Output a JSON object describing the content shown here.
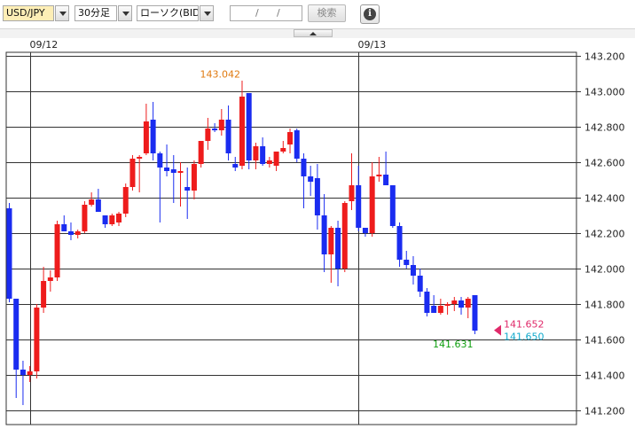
{
  "toolbar": {
    "pair": "USD/JPY",
    "interval": "30分足",
    "chart_type": "ローソク(BID)",
    "date_sep1": "/",
    "date_sep2": "/",
    "search_label": "検索",
    "info_icon": "info-icon"
  },
  "colors": {
    "up": "#ee1c1c",
    "down": "#1a2cf0",
    "grid": "#333333",
    "high_label": "#e07a10",
    "low_label": "#11a011",
    "price1": "#e02a6a",
    "price2": "#11aacc"
  },
  "chart_data": {
    "type": "candlestick",
    "y_range": [
      141.12,
      143.22
    ],
    "y_ticks": [
      "143.200",
      "143.000",
      "142.800",
      "142.600",
      "142.400",
      "142.200",
      "142.000",
      "141.800",
      "141.600",
      "141.400",
      "141.200"
    ],
    "date_labels": [
      {
        "text": "09/12",
        "index": 3
      },
      {
        "text": "09/13",
        "index": 51
      }
    ],
    "annotations": {
      "high": "143.042",
      "low": "141.631",
      "price_marker_1": "141.652",
      "price_marker_2": "141.650"
    },
    "ohlc": [
      [
        142.34,
        142.37,
        141.81,
        141.83
      ],
      [
        141.83,
        141.83,
        141.27,
        141.43
      ],
      [
        141.43,
        141.48,
        141.23,
        141.4
      ],
      [
        141.4,
        141.45,
        141.36,
        141.42
      ],
      [
        141.42,
        141.8,
        141.38,
        141.78
      ],
      [
        141.78,
        142.01,
        141.75,
        141.93
      ],
      [
        141.93,
        141.99,
        141.87,
        141.95
      ],
      [
        141.95,
        142.27,
        141.93,
        142.25
      ],
      [
        142.25,
        142.3,
        142.21,
        142.21
      ],
      [
        142.21,
        142.26,
        142.16,
        142.19
      ],
      [
        142.19,
        142.22,
        142.17,
        142.21
      ],
      [
        142.21,
        142.38,
        142.2,
        142.36
      ],
      [
        142.36,
        142.43,
        142.35,
        142.39
      ],
      [
        142.39,
        142.45,
        142.32,
        142.32
      ],
      [
        142.3,
        142.3,
        142.23,
        142.25
      ],
      [
        142.25,
        142.31,
        142.24,
        142.3
      ],
      [
        142.26,
        142.32,
        142.24,
        142.31
      ],
      [
        142.31,
        142.48,
        142.29,
        142.46
      ],
      [
        142.46,
        142.64,
        142.44,
        142.62
      ],
      [
        142.62,
        142.64,
        142.43,
        142.63
      ],
      [
        142.65,
        142.93,
        142.64,
        142.83
      ],
      [
        142.84,
        142.94,
        142.61,
        142.65
      ],
      [
        142.65,
        142.66,
        142.26,
        142.57
      ],
      [
        142.57,
        142.7,
        142.52,
        142.55
      ],
      [
        142.56,
        142.64,
        142.37,
        142.54
      ],
      [
        142.54,
        142.6,
        142.35,
        142.55
      ],
      [
        142.46,
        142.57,
        142.28,
        142.44
      ],
      [
        142.44,
        142.61,
        142.39,
        142.59
      ],
      [
        142.59,
        142.72,
        142.57,
        142.72
      ],
      [
        142.72,
        142.85,
        142.67,
        142.79
      ],
      [
        142.79,
        142.82,
        142.77,
        142.78
      ],
      [
        142.78,
        142.9,
        142.75,
        142.84
      ],
      [
        142.84,
        142.92,
        142.61,
        142.65
      ],
      [
        142.59,
        142.63,
        142.55,
        142.57
      ],
      [
        142.58,
        143.06,
        142.56,
        142.97
      ],
      [
        142.99,
        142.99,
        142.56,
        142.61
      ],
      [
        142.61,
        142.71,
        142.56,
        142.69
      ],
      [
        142.69,
        142.74,
        142.58,
        142.59
      ],
      [
        142.59,
        142.63,
        142.57,
        142.61
      ],
      [
        142.58,
        142.66,
        142.55,
        142.66
      ],
      [
        142.66,
        142.72,
        142.65,
        142.68
      ],
      [
        142.7,
        142.79,
        142.65,
        142.77
      ],
      [
        142.78,
        142.79,
        142.6,
        142.62
      ],
      [
        142.62,
        142.65,
        142.34,
        142.52
      ],
      [
        142.52,
        142.58,
        142.41,
        142.49
      ],
      [
        142.51,
        142.59,
        142.22,
        142.3
      ],
      [
        142.3,
        142.42,
        141.98,
        142.08
      ],
      [
        142.08,
        142.24,
        141.92,
        142.23
      ],
      [
        142.23,
        142.27,
        141.9,
        142.0
      ],
      [
        142.0,
        142.38,
        141.98,
        142.37
      ],
      [
        142.38,
        142.65,
        142.33,
        142.47
      ],
      [
        142.47,
        142.58,
        142.21,
        142.23
      ],
      [
        142.23,
        142.23,
        142.18,
        142.2
      ],
      [
        142.2,
        142.6,
        142.18,
        142.52
      ],
      [
        142.52,
        142.63,
        142.49,
        142.53
      ],
      [
        142.53,
        142.66,
        142.47,
        142.47
      ],
      [
        142.47,
        142.47,
        142.23,
        142.24
      ],
      [
        142.24,
        142.26,
        142.01,
        142.05
      ],
      [
        142.05,
        142.1,
        142.0,
        142.02
      ],
      [
        142.02,
        142.07,
        141.91,
        141.96
      ],
      [
        141.96,
        142.0,
        141.84,
        141.87
      ],
      [
        141.87,
        141.89,
        141.73,
        141.75
      ],
      [
        141.79,
        141.85,
        141.75,
        141.75
      ],
      [
        141.75,
        141.83,
        141.74,
        141.79
      ],
      [
        141.79,
        141.81,
        141.74,
        141.8
      ],
      [
        141.8,
        141.84,
        141.76,
        141.82
      ],
      [
        141.82,
        141.84,
        141.74,
        141.78
      ],
      [
        141.78,
        141.84,
        141.72,
        141.83
      ],
      [
        141.85,
        141.85,
        141.63,
        141.65
      ]
    ]
  }
}
